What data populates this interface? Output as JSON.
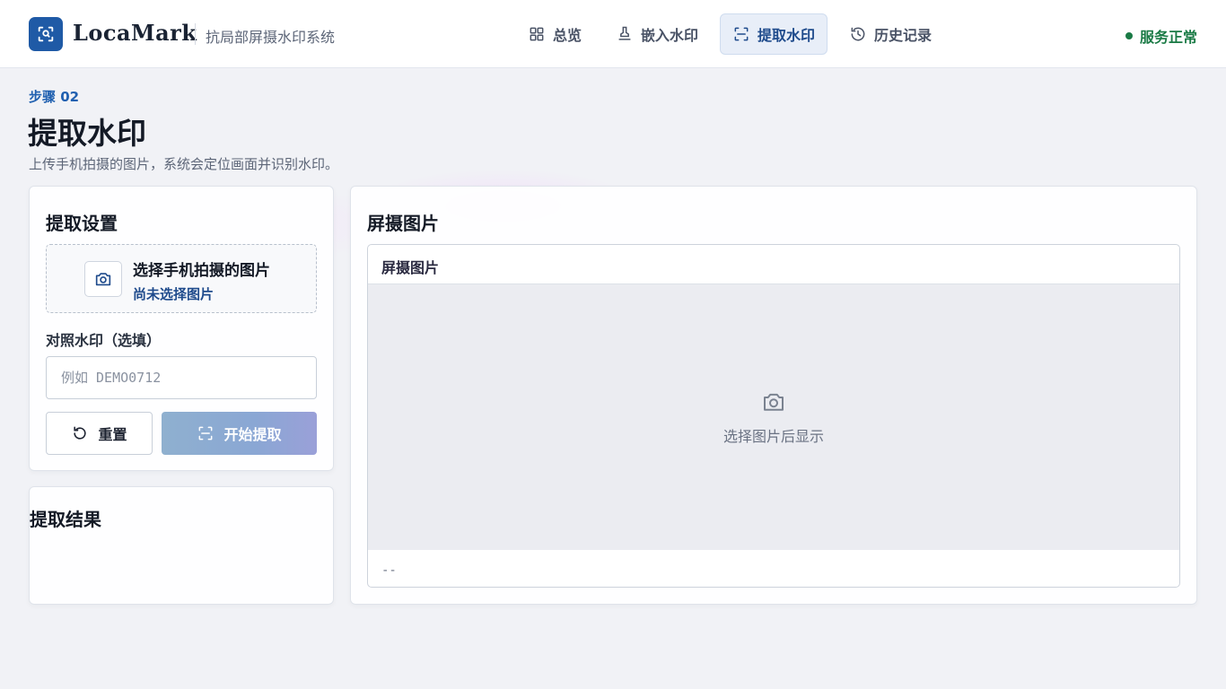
{
  "header": {
    "brand": "LocaMark",
    "subtitle": "抗局部屏摄水印系统",
    "nav": [
      {
        "label": "总览",
        "icon": "grid-icon"
      },
      {
        "label": "嵌入水印",
        "icon": "stamp-icon"
      },
      {
        "label": "提取水印",
        "icon": "scan-icon",
        "active": true
      },
      {
        "label": "历史记录",
        "icon": "history-icon"
      }
    ],
    "status": "服务正常",
    "status_color": "#1a7a45"
  },
  "page": {
    "step": "步骤 02",
    "title": "提取水印",
    "description": "上传手机拍摄的图片，系统会定位画面并识别水印。"
  },
  "settings": {
    "title": "提取设置",
    "upload_title": "选择手机拍摄的图片",
    "upload_status": "尚未选择图片",
    "reference_label": "对照水印（选填）",
    "reference_placeholder": "例如 DEMO0712",
    "reference_value": "",
    "reset_label": "重置",
    "start_label": "开始提取"
  },
  "result": {
    "title": "提取结果"
  },
  "preview": {
    "title": "屏摄图片",
    "frame_title": "屏摄图片",
    "hint": "选择图片后显示",
    "footer": "--"
  },
  "colors": {
    "accent": "#1f5aa6",
    "active_nav_bg": "#e8eef8"
  }
}
